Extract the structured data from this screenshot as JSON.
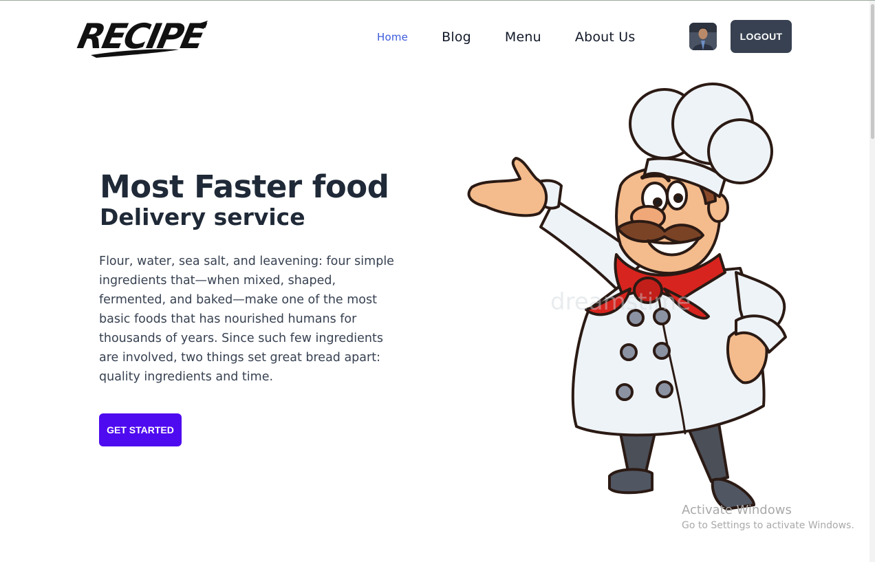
{
  "header": {
    "logo_text": "RECIPE",
    "nav": [
      {
        "label": "Home",
        "active": true
      },
      {
        "label": "Blog",
        "active": false
      },
      {
        "label": "Menu",
        "active": false
      },
      {
        "label": "About Us",
        "active": false
      }
    ],
    "logout_label": "LOGOUT"
  },
  "hero": {
    "title": "Most Faster food",
    "subtitle": "Delivery service",
    "paragraph": "Flour, water, sea salt, and leavening: four simple ingredients that—when mixed, shaped, fermented, and baked—make one of the most basic foods that has nourished humans for thousands of years. Since such few ingredients are involved, two things set great bread apart: quality ingredients and time.",
    "cta_label": "GET STARTED"
  },
  "illustration": {
    "watermark_text": "dreamstime"
  },
  "os_watermark": {
    "title": "Activate Windows",
    "subtitle": "Go to Settings to activate Windows."
  },
  "colors": {
    "nav_active": "#3b5bdb",
    "cta": "#4f0bef",
    "logout": "#374151",
    "text": "#1f2937"
  }
}
